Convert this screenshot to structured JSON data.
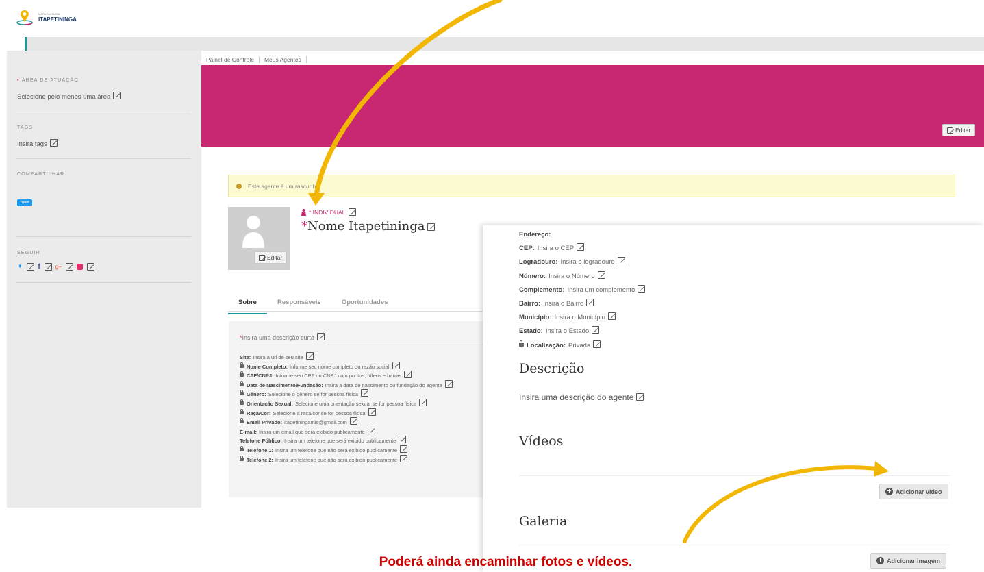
{
  "logo": {
    "small": "MAPA CULTURAL",
    "name": "ITAPETININGA"
  },
  "breadcrumb": [
    "Painel de Controle",
    "Meus Agentes"
  ],
  "sidebar": {
    "area_title": "ÁREA DE ATUAÇÃO",
    "area_text": "Selecione pelo menos uma área",
    "tags_title": "TAGS",
    "tags_text": "Insira tags",
    "share_title": "COMPARTILHAR",
    "tweet": "Tweet",
    "follow_title": "SEGUIR"
  },
  "banner": {
    "edit": "Editar",
    "color": "#c82872"
  },
  "warning": "Este agente é um rascunho",
  "avatar": {
    "edit": "Editar"
  },
  "agent": {
    "type": "INDIVIDUAL",
    "name": "Nome Itapetininga"
  },
  "tabs": [
    "Sobre",
    "Responsáveis",
    "Oportunidades"
  ],
  "short_description": "Insira uma descrição curta",
  "fields": [
    {
      "label": "Site:",
      "value": "Insira a url de seu site",
      "lock": false
    },
    {
      "label": "Nome Completo:",
      "value": "Informe seu nome completo ou razão social",
      "lock": true
    },
    {
      "label": "CPF/CNPJ:",
      "value": "Informe seu CPF ou CNPJ com pontos, hífens e barras",
      "lock": true
    },
    {
      "label": "Data de Nascimento/Fundação:",
      "value": "Insira a data de nascimento ou fundação do agente",
      "lock": true
    },
    {
      "label": "Gênero:",
      "value": "Selecione o gênero se for pessoa física",
      "lock": true
    },
    {
      "label": "Orientação Sexual:",
      "value": "Selecione uma orientação sexual se for pessoa física",
      "lock": true
    },
    {
      "label": "Raça/Cor:",
      "value": "Selecione a raça/cor se for pessoa física",
      "lock": true
    },
    {
      "label": "Email Privado:",
      "value": "itapetiningamis@gmail.com",
      "lock": true
    },
    {
      "label": "E-mail:",
      "value": "Insira um email que será exibido publicamente",
      "lock": false
    },
    {
      "label": "Telefone Público:",
      "value": "Insira um telefone que será exibido publicamente",
      "lock": false
    },
    {
      "label": "Telefone 1:",
      "value": "Insira um telefone que não será exibido publicamente",
      "lock": true
    },
    {
      "label": "Telefone 2:",
      "value": "Insira um telefone que não será exibido publicamente",
      "lock": true
    }
  ],
  "address": {
    "title": "Endereço:",
    "rows": [
      {
        "label": "CEP:",
        "value": "Insira o CEP",
        "lock": false
      },
      {
        "label": "Logradouro:",
        "value": "Insira o logradouro",
        "lock": false
      },
      {
        "label": "Número:",
        "value": "Insira o Número",
        "lock": false
      },
      {
        "label": "Complemento:",
        "value": "Insira um complemento",
        "lock": false
      },
      {
        "label": "Bairro:",
        "value": "Insira o Bairro",
        "lock": false
      },
      {
        "label": "Município:",
        "value": "Insira o Município",
        "lock": false
      },
      {
        "label": "Estado:",
        "value": "Insira o Estado",
        "lock": false
      },
      {
        "label": "Localização:",
        "value": "Privada",
        "lock": true
      }
    ]
  },
  "description": {
    "title": "Descrição",
    "text": "Insira uma descrição do agente"
  },
  "videos": {
    "title": "Vídeos",
    "button": "Adicionar vídeo"
  },
  "gallery": {
    "title": "Galeria",
    "button": "Adicionar imagem"
  },
  "caption": "Poderá ainda encaminhar fotos e vídeos.",
  "colors": {
    "accent": "#c82872",
    "teal": "#1a9a9a",
    "arrow": "#f2b705",
    "caption": "#d00000"
  }
}
